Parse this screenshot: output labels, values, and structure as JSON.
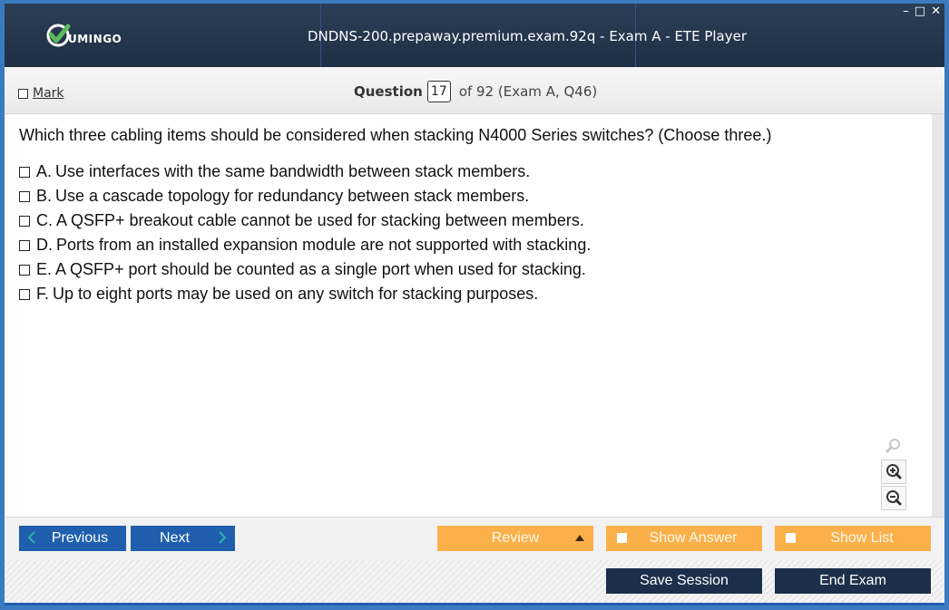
{
  "app": {
    "logo_text": "UMINGO",
    "title": "DNDNS-200.prepaway.premium.exam.92q - Exam A - ETE Player",
    "window_controls": {
      "minimize": "–",
      "maximize": "□",
      "close": "✕"
    }
  },
  "question_bar": {
    "mark_label": "Mark",
    "question_label": "Question",
    "question_number": "17",
    "of_text": "of 92 (Exam A, Q46)"
  },
  "question": {
    "text": "Which three cabling items should be considered when stacking N4000 Series switches? (Choose three.)",
    "options": [
      {
        "letter": "A.",
        "text": "Use interfaces with the same bandwidth between stack members."
      },
      {
        "letter": "B.",
        "text": "Use a cascade topology for redundancy between stack members."
      },
      {
        "letter": "C.",
        "text": "A QSFP+ breakout cable cannot be used for stacking between members."
      },
      {
        "letter": "D.",
        "text": "Ports from an installed expansion module are not supported with stacking."
      },
      {
        "letter": "E.",
        "text": "A QSFP+ port should be counted as a single port when used for stacking."
      },
      {
        "letter": "F.",
        "text": "Up to eight ports may be used on any switch for stacking purposes."
      }
    ]
  },
  "zoom": {
    "icons": [
      "search-icon",
      "zoom-in-icon",
      "zoom-out-icon"
    ]
  },
  "nav": {
    "previous_label": "Previous",
    "next_label": "Next",
    "review_label": "Review",
    "show_answer_label": "Show Answer",
    "show_list_label": "Show List"
  },
  "footer": {
    "save_session_label": "Save Session",
    "end_exam_label": "End Exam"
  },
  "colors": {
    "title_bar": "#1f2f45",
    "primary_button": "#1f5fae",
    "orange_button": "#fbb04a",
    "dark_button": "#1c2f4a",
    "logo_green": "#5cb85c"
  }
}
